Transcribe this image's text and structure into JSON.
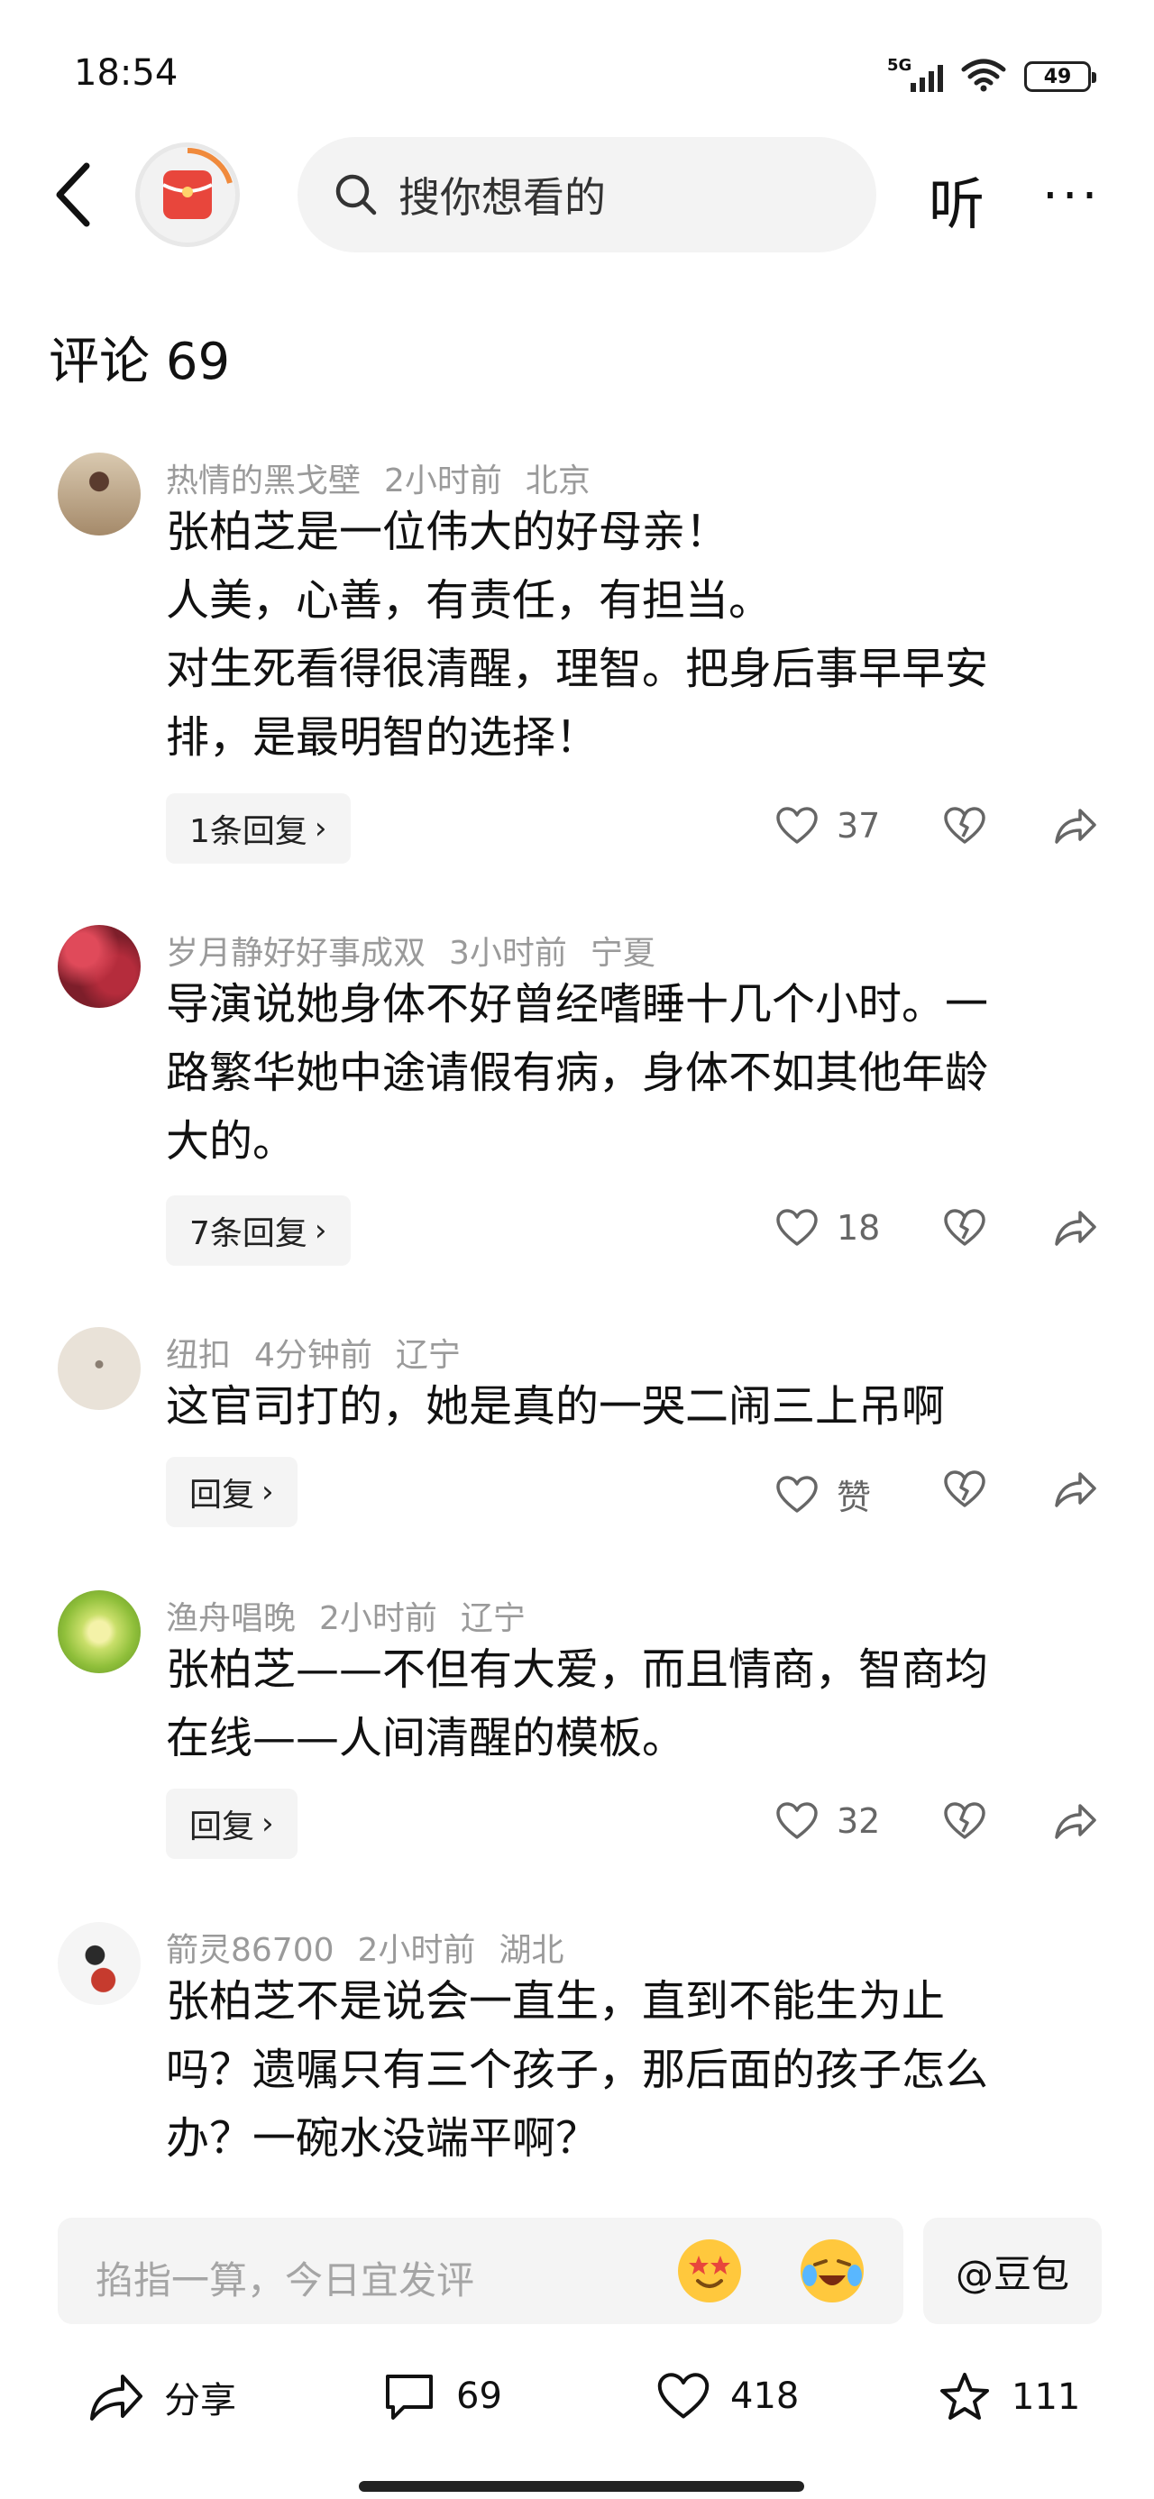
{
  "status_bar": {
    "time": "18:54",
    "network": "5G",
    "battery": "49"
  },
  "header": {
    "search_placeholder": "搜你想看的",
    "listen_label": "听",
    "more_label": "···"
  },
  "comments_header": {
    "label": "评论",
    "count": "69"
  },
  "comments": [
    {
      "username": "热情的黑戈壁",
      "time": "2小时前",
      "location": "北京",
      "lines": [
        "张柏芝是一位伟大的好母亲！",
        "人美，心善，有责任，有担当。",
        "对生死看得很清醒，理智。把身后事早早安",
        "排，是最明智的选择！"
      ],
      "reply_label": "1条回复",
      "likes": "37"
    },
    {
      "username": "岁月静好好事成双",
      "time": "3小时前",
      "location": "宁夏",
      "lines": [
        "导演说她身体不好曾经嗜睡十几个小时。一",
        "路繁华她中途请假有病，身体不如其他年龄",
        "大的。"
      ],
      "reply_label": "7条回复",
      "likes": "18"
    },
    {
      "username": "纽扣",
      "time": "4分钟前",
      "location": "辽宁",
      "lines": [
        "这官司打的，她是真的一哭二闹三上吊啊"
      ],
      "reply_label": "回复",
      "likes": "赞"
    },
    {
      "username": "渔舟唱晚",
      "time": "2小时前",
      "location": "辽宁",
      "lines": [
        "张柏芝——不但有大爱，而且情商，智商均",
        "在线——人间清醒的模板。"
      ],
      "reply_label": "回复",
      "likes": "32"
    },
    {
      "username": "箭灵86700",
      "time": "2小时前",
      "location": "湖北",
      "lines": [
        "张柏芝不是说会一直生，直到不能生为止",
        "吗？遗嘱只有三个孩子，那后面的孩子怎么",
        "办？一碗水没端平啊？"
      ]
    }
  ],
  "input": {
    "placeholder": "掐指一算，今日宜发评",
    "doubao_label": "@豆包"
  },
  "bottom_bar": {
    "share_label": "分享",
    "comment_count": "69",
    "like_count": "418",
    "favorite_count": "111"
  },
  "colors": {
    "meta_gray": "#9a9a9a",
    "text": "#111111",
    "chip_bg": "#f4f4f4",
    "brand_red": "#e8463c"
  }
}
